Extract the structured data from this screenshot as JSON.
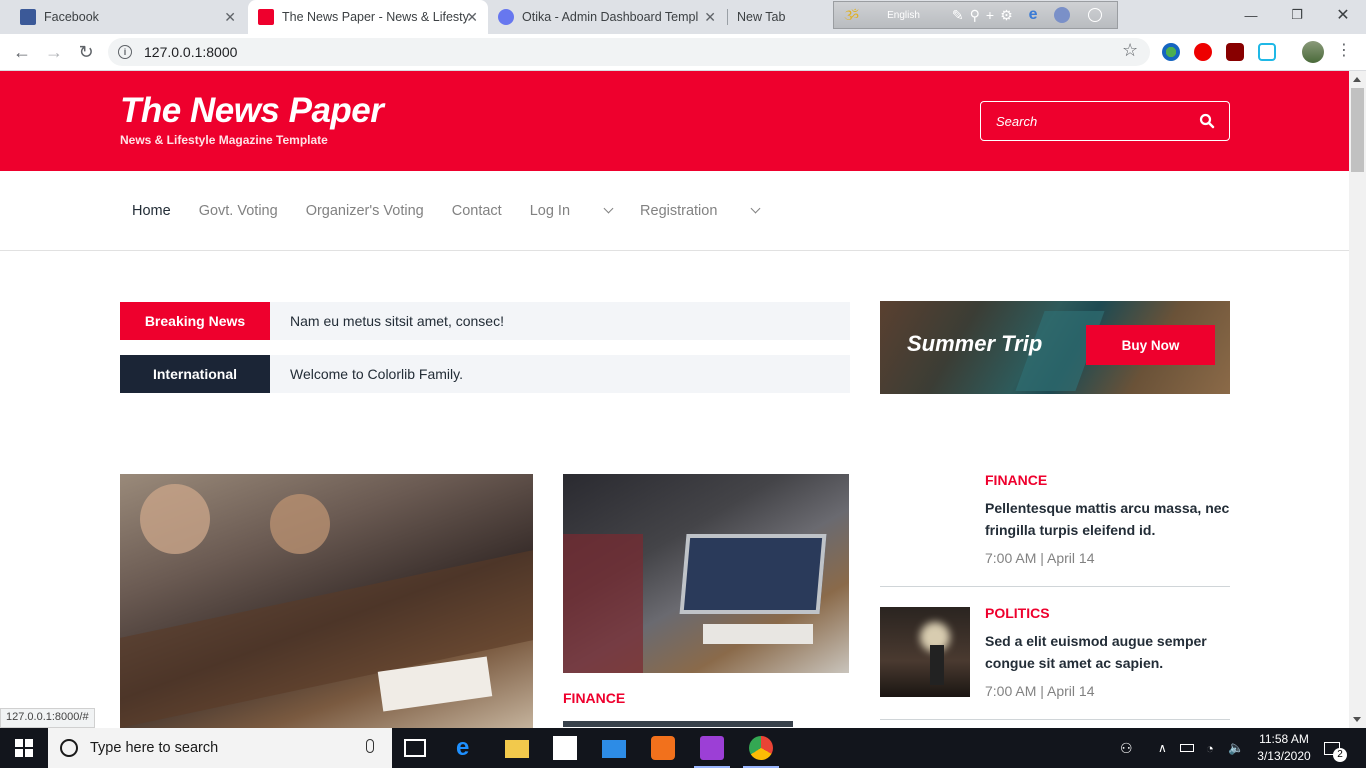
{
  "browser": {
    "tabs": [
      {
        "title": "Facebook",
        "active": false
      },
      {
        "title": "The News Paper - News & Lifesty",
        "active": true
      },
      {
        "title": "Otika - Admin Dashboard Templ",
        "active": false
      },
      {
        "title": "New Tab",
        "active": false
      }
    ],
    "language_bar": {
      "label": "English"
    },
    "url": "127.0.0.1:8000",
    "status_url": "127.0.0.1:8000/#"
  },
  "site": {
    "title": "The News Paper",
    "tagline": "News & Lifestyle Magazine Template",
    "search_placeholder": "Search",
    "nav": [
      {
        "label": "Home"
      },
      {
        "label": "Govt. Voting"
      },
      {
        "label": "Organizer's Voting"
      },
      {
        "label": "Contact"
      },
      {
        "label": "Log In"
      },
      {
        "label": "Registration"
      }
    ],
    "tickers": [
      {
        "label": "Breaking News",
        "text": "Nam eu metus sitsit amet, consec!",
        "color": "#ee002d"
      },
      {
        "label": "International",
        "text": "Welcome to Colorlib Family.",
        "color": "#1b2536"
      }
    ],
    "ad": {
      "title": "Summer Trip",
      "button": "Buy Now"
    },
    "featured_middle": {
      "category": "FINANCE"
    },
    "side_posts": [
      {
        "category": "FINANCE",
        "headline": "Pellentesque mattis arcu massa, nec fringilla turpis eleifend id.",
        "meta": "7:00 AM | April 14"
      },
      {
        "category": "POLITICS",
        "headline": "Sed a elit euismod augue semper congue sit amet ac sapien.",
        "meta": "7:00 AM | April 14"
      }
    ],
    "accent_color": "#ee002d"
  },
  "taskbar": {
    "search_placeholder": "Type here to search",
    "time": "11:58 AM",
    "date": "3/13/2020",
    "notifications": "2"
  }
}
